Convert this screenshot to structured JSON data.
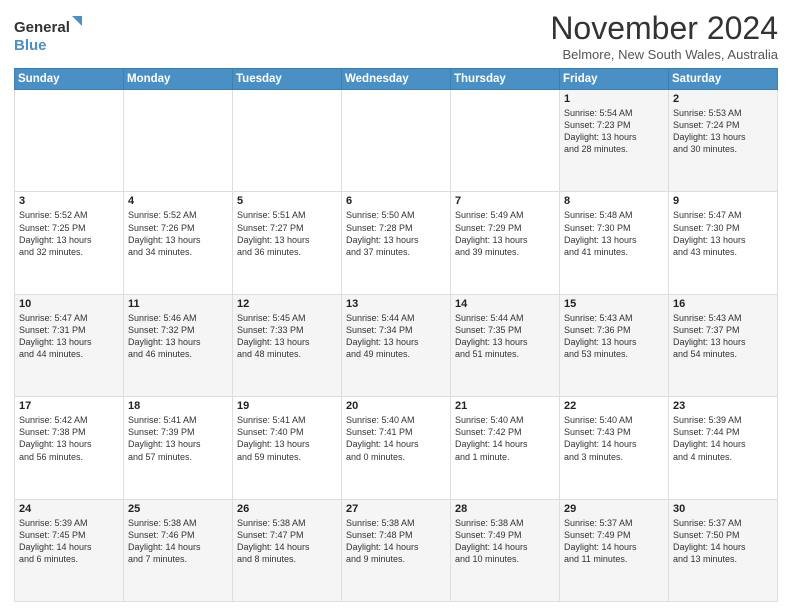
{
  "logo": {
    "line1": "General",
    "line2": "Blue"
  },
  "header": {
    "title": "November 2024",
    "location": "Belmore, New South Wales, Australia"
  },
  "days_of_week": [
    "Sunday",
    "Monday",
    "Tuesday",
    "Wednesday",
    "Thursday",
    "Friday",
    "Saturday"
  ],
  "weeks": [
    [
      {
        "num": "",
        "detail": ""
      },
      {
        "num": "",
        "detail": ""
      },
      {
        "num": "",
        "detail": ""
      },
      {
        "num": "",
        "detail": ""
      },
      {
        "num": "",
        "detail": ""
      },
      {
        "num": "1",
        "detail": "Sunrise: 5:54 AM\nSunset: 7:23 PM\nDaylight: 13 hours\nand 28 minutes."
      },
      {
        "num": "2",
        "detail": "Sunrise: 5:53 AM\nSunset: 7:24 PM\nDaylight: 13 hours\nand 30 minutes."
      }
    ],
    [
      {
        "num": "3",
        "detail": "Sunrise: 5:52 AM\nSunset: 7:25 PM\nDaylight: 13 hours\nand 32 minutes."
      },
      {
        "num": "4",
        "detail": "Sunrise: 5:52 AM\nSunset: 7:26 PM\nDaylight: 13 hours\nand 34 minutes."
      },
      {
        "num": "5",
        "detail": "Sunrise: 5:51 AM\nSunset: 7:27 PM\nDaylight: 13 hours\nand 36 minutes."
      },
      {
        "num": "6",
        "detail": "Sunrise: 5:50 AM\nSunset: 7:28 PM\nDaylight: 13 hours\nand 37 minutes."
      },
      {
        "num": "7",
        "detail": "Sunrise: 5:49 AM\nSunset: 7:29 PM\nDaylight: 13 hours\nand 39 minutes."
      },
      {
        "num": "8",
        "detail": "Sunrise: 5:48 AM\nSunset: 7:30 PM\nDaylight: 13 hours\nand 41 minutes."
      },
      {
        "num": "9",
        "detail": "Sunrise: 5:47 AM\nSunset: 7:30 PM\nDaylight: 13 hours\nand 43 minutes."
      }
    ],
    [
      {
        "num": "10",
        "detail": "Sunrise: 5:47 AM\nSunset: 7:31 PM\nDaylight: 13 hours\nand 44 minutes."
      },
      {
        "num": "11",
        "detail": "Sunrise: 5:46 AM\nSunset: 7:32 PM\nDaylight: 13 hours\nand 46 minutes."
      },
      {
        "num": "12",
        "detail": "Sunrise: 5:45 AM\nSunset: 7:33 PM\nDaylight: 13 hours\nand 48 minutes."
      },
      {
        "num": "13",
        "detail": "Sunrise: 5:44 AM\nSunset: 7:34 PM\nDaylight: 13 hours\nand 49 minutes."
      },
      {
        "num": "14",
        "detail": "Sunrise: 5:44 AM\nSunset: 7:35 PM\nDaylight: 13 hours\nand 51 minutes."
      },
      {
        "num": "15",
        "detail": "Sunrise: 5:43 AM\nSunset: 7:36 PM\nDaylight: 13 hours\nand 53 minutes."
      },
      {
        "num": "16",
        "detail": "Sunrise: 5:43 AM\nSunset: 7:37 PM\nDaylight: 13 hours\nand 54 minutes."
      }
    ],
    [
      {
        "num": "17",
        "detail": "Sunrise: 5:42 AM\nSunset: 7:38 PM\nDaylight: 13 hours\nand 56 minutes."
      },
      {
        "num": "18",
        "detail": "Sunrise: 5:41 AM\nSunset: 7:39 PM\nDaylight: 13 hours\nand 57 minutes."
      },
      {
        "num": "19",
        "detail": "Sunrise: 5:41 AM\nSunset: 7:40 PM\nDaylight: 13 hours\nand 59 minutes."
      },
      {
        "num": "20",
        "detail": "Sunrise: 5:40 AM\nSunset: 7:41 PM\nDaylight: 14 hours\nand 0 minutes."
      },
      {
        "num": "21",
        "detail": "Sunrise: 5:40 AM\nSunset: 7:42 PM\nDaylight: 14 hours\nand 1 minute."
      },
      {
        "num": "22",
        "detail": "Sunrise: 5:40 AM\nSunset: 7:43 PM\nDaylight: 14 hours\nand 3 minutes."
      },
      {
        "num": "23",
        "detail": "Sunrise: 5:39 AM\nSunset: 7:44 PM\nDaylight: 14 hours\nand 4 minutes."
      }
    ],
    [
      {
        "num": "24",
        "detail": "Sunrise: 5:39 AM\nSunset: 7:45 PM\nDaylight: 14 hours\nand 6 minutes."
      },
      {
        "num": "25",
        "detail": "Sunrise: 5:38 AM\nSunset: 7:46 PM\nDaylight: 14 hours\nand 7 minutes."
      },
      {
        "num": "26",
        "detail": "Sunrise: 5:38 AM\nSunset: 7:47 PM\nDaylight: 14 hours\nand 8 minutes."
      },
      {
        "num": "27",
        "detail": "Sunrise: 5:38 AM\nSunset: 7:48 PM\nDaylight: 14 hours\nand 9 minutes."
      },
      {
        "num": "28",
        "detail": "Sunrise: 5:38 AM\nSunset: 7:49 PM\nDaylight: 14 hours\nand 10 minutes."
      },
      {
        "num": "29",
        "detail": "Sunrise: 5:37 AM\nSunset: 7:49 PM\nDaylight: 14 hours\nand 11 minutes."
      },
      {
        "num": "30",
        "detail": "Sunrise: 5:37 AM\nSunset: 7:50 PM\nDaylight: 14 hours\nand 13 minutes."
      }
    ]
  ]
}
